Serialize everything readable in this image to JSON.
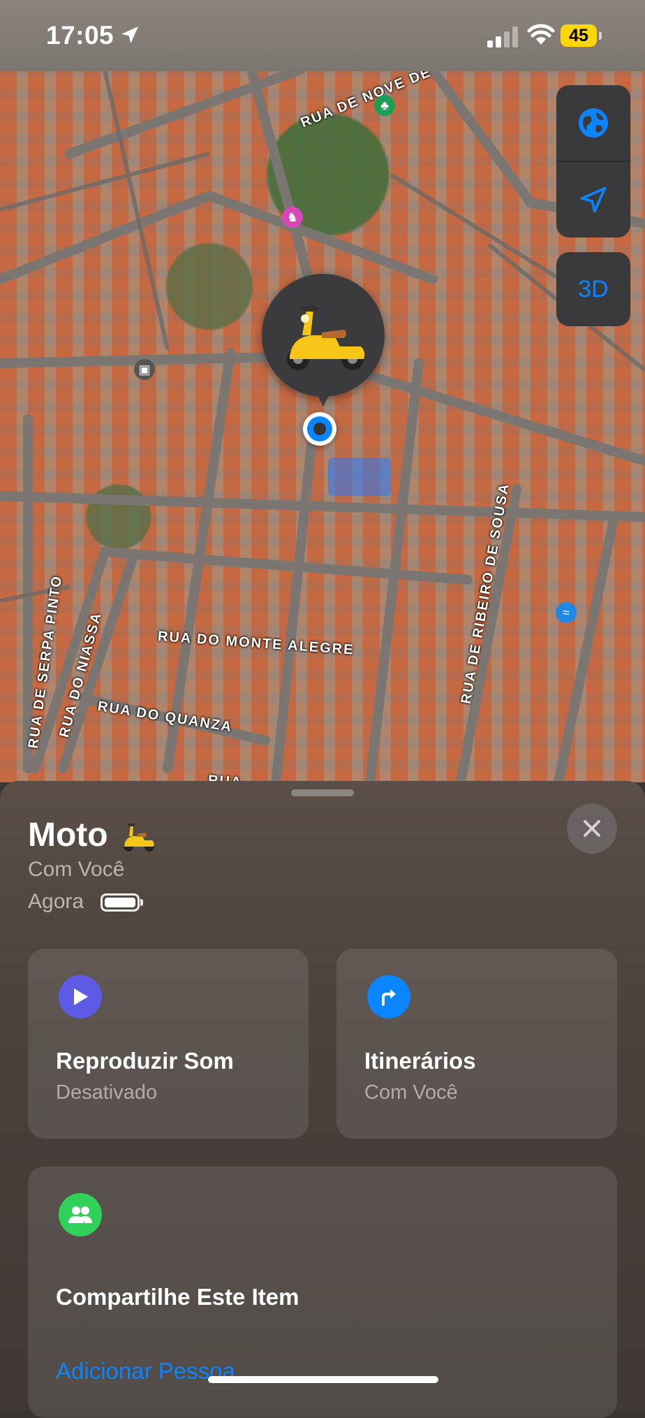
{
  "status": {
    "time": "17:05",
    "battery": "45"
  },
  "map": {
    "streets": [
      "RUA DE NOVE DE",
      "RUA DO MONTE ALEGRE",
      "RUA DO QUANZA",
      "RUA DO NIASSA",
      "RUA DE SERPA PINTO",
      "RUA DE RIBEIRO DE SOUSA",
      "RUA"
    ],
    "controls": {
      "map_type_icon": "globe-icon",
      "tracking_icon": "location-arrow-icon",
      "mode_3d_label": "3D"
    },
    "pin_icon": "scooter-emoji",
    "accent_color": "#0a84ff"
  },
  "sheet": {
    "title": "Moto",
    "title_icon": "scooter-emoji",
    "status": "Com Você",
    "updated": "Agora",
    "close_icon": "close-icon",
    "actions": [
      {
        "icon": "play-icon",
        "icon_color": "#5e5ce6",
        "title": "Reproduzir Som",
        "subtitle": "Desativado"
      },
      {
        "icon": "directions-arrow-icon",
        "icon_color": "#0a84ff",
        "title": "Itinerários",
        "subtitle": "Com Você"
      }
    ],
    "share": {
      "icon": "people-icon",
      "icon_color": "#30d158",
      "title": "Compartilhe Este Item",
      "link": "Adicionar Pessoa"
    }
  }
}
